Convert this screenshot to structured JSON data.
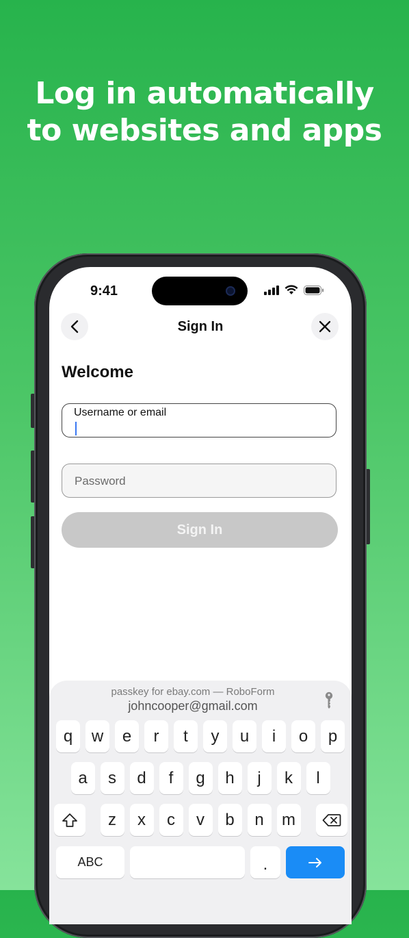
{
  "headline": {
    "line1": "Log in automatically",
    "line2": "to websites and apps"
  },
  "status_bar": {
    "time": "9:41"
  },
  "nav": {
    "title": "Sign In"
  },
  "form": {
    "heading": "Welcome",
    "username_label": "Username or email",
    "password_placeholder": "Password",
    "signin_label": "Sign In"
  },
  "autofill": {
    "source": "passkey for ebay.com — RoboForm",
    "account": "johncooper@gmail.com"
  },
  "keyboard": {
    "row1": [
      "q",
      "w",
      "e",
      "r",
      "t",
      "y",
      "u",
      "i",
      "o",
      "p"
    ],
    "row2": [
      "a",
      "s",
      "d",
      "f",
      "g",
      "h",
      "j",
      "k",
      "l"
    ],
    "row3": [
      "z",
      "x",
      "c",
      "v",
      "b",
      "n",
      "m"
    ],
    "abc_label": "ABC",
    "dot_label": "."
  },
  "colors": {
    "gradient_top": "#27b34c",
    "gradient_bottom": "#86e39b",
    "return_key": "#1a8cf6",
    "disabled_button": "#c8c8c8"
  }
}
